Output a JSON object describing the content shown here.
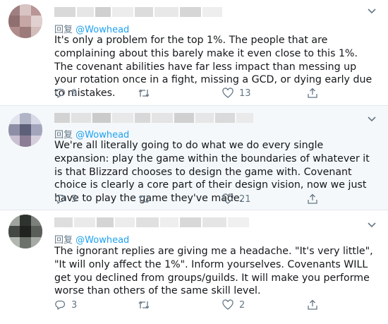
{
  "colors": {
    "accent": "#1da1f2",
    "muted": "#657786",
    "text": "#14171a",
    "highlight_bg": "#f5f8fa",
    "divider": "#e1e8ed"
  },
  "tweets": [
    {
      "reply_prefix": "回复",
      "reply_handle": "@Wowhead",
      "text": "It's only a problem for the top 1%. The people that are complaining about this barely make it even close to this 1%. The  covenant abilities have far less impact than messing up your rotation once in a fight, missing a GCD, or dying early due to mistakes.",
      "reply_count": "9",
      "retweet_count": "",
      "like_count": "13"
    },
    {
      "reply_prefix": "回复",
      "reply_handle": "@Wowhead",
      "text": "We're all literally going to do what we do every single expansion: play the game within the boundaries of whatever it is that Blizzard chooses to design the game with. Covenant choice is clearly a core part of their design vision, now we just have to play the game they've made.",
      "reply_count": "5",
      "retweet_count": "",
      "like_count": "21"
    },
    {
      "reply_prefix": "回复",
      "reply_handle": "@Wowhead",
      "text": "The ignorant replies are giving me a headache. \"It's very little\", \"It will only affect the 1%\". Inform yourselves. Covenants WILL get you declined from groups/guilds. It will make you performe worse than others of the same skill level.",
      "reply_count": "3",
      "retweet_count": "",
      "like_count": "2"
    }
  ],
  "icons": [
    "reply-icon",
    "retweet-icon",
    "like-icon",
    "share-icon",
    "chevron-down-icon"
  ]
}
